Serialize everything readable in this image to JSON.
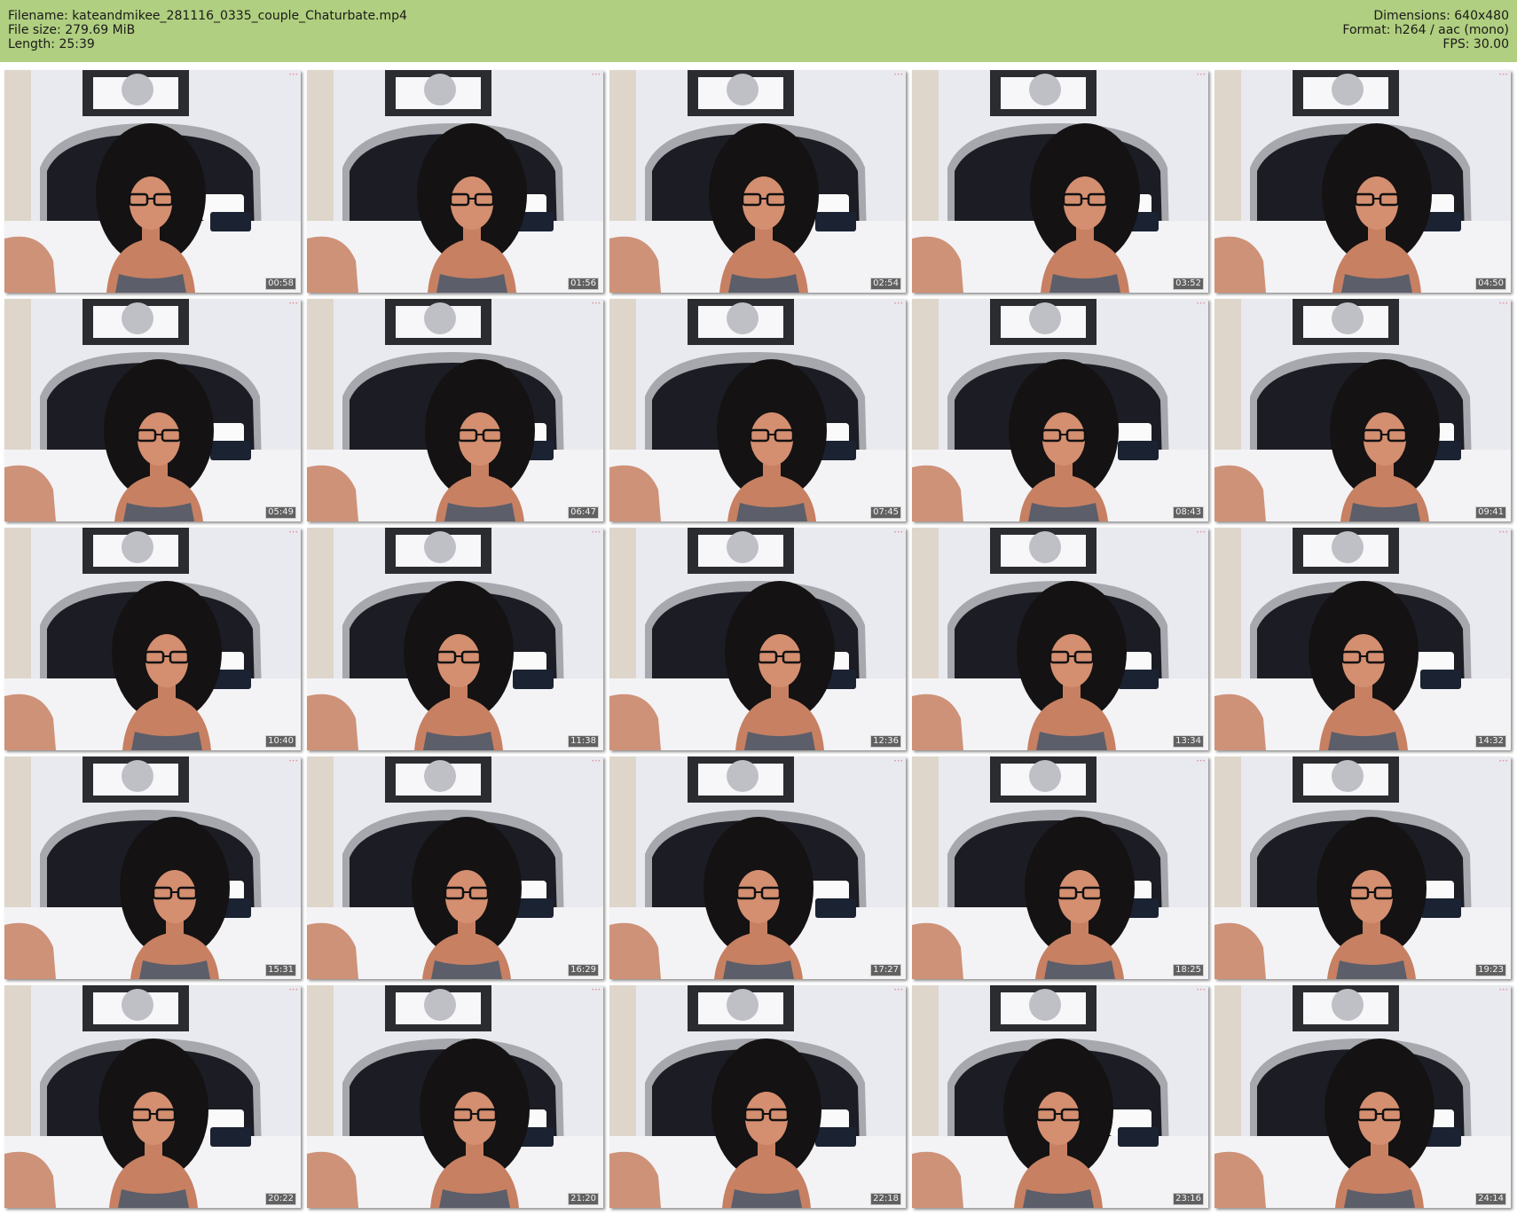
{
  "header": {
    "filename": "Filename: kateandmikee_281116_0335_couple_Chaturbate.mp4",
    "filesize": "File size: 279.69 MiB",
    "length": "Length: 25:39",
    "dimensions": "Dimensions: 640x480",
    "format": "Format: h264 / aac (mono)",
    "fps": "FPS: 30.00"
  },
  "colors": {
    "header_bg": "#b0cf80",
    "wall": "#e9eaef",
    "headboard": "#1c1d24",
    "frame_silver": "#a6a8ae",
    "bedding": "#f3f3f6",
    "hair": "#141212",
    "skin": "#c78062"
  },
  "thumbnails": [
    {
      "time": "00:58"
    },
    {
      "time": "01:56"
    },
    {
      "time": "02:54"
    },
    {
      "time": "03:52"
    },
    {
      "time": "04:50"
    },
    {
      "time": "05:49"
    },
    {
      "time": "06:47"
    },
    {
      "time": "07:45"
    },
    {
      "time": "08:43"
    },
    {
      "time": "09:41"
    },
    {
      "time": "10:40"
    },
    {
      "time": "11:38"
    },
    {
      "time": "12:36"
    },
    {
      "time": "13:34"
    },
    {
      "time": "14:32"
    },
    {
      "time": "15:31"
    },
    {
      "time": "16:29"
    },
    {
      "time": "17:27"
    },
    {
      "time": "18:25"
    },
    {
      "time": "19:23"
    },
    {
      "time": "20:22"
    },
    {
      "time": "21:20"
    },
    {
      "time": "22:18"
    },
    {
      "time": "23:16"
    },
    {
      "time": "24:14"
    }
  ]
}
